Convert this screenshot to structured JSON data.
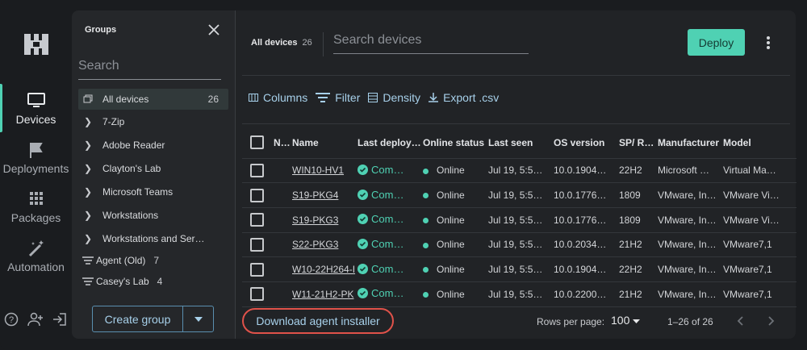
{
  "nav": {
    "devices": "Devices",
    "deployments": "Deployments",
    "packages": "Packages",
    "automation": "Automation"
  },
  "groups": {
    "title": "Groups",
    "search_placeholder": "Search",
    "items": [
      {
        "label": "All devices",
        "count": "26"
      },
      {
        "label": "7-Zip"
      },
      {
        "label": "Adobe Reader"
      },
      {
        "label": "Clayton's Lab"
      },
      {
        "label": "Microsoft Teams"
      },
      {
        "label": "Workstations"
      },
      {
        "label": "Workstations and Ser…"
      },
      {
        "label": "Agent (Old)",
        "count": "7"
      },
      {
        "label": "Casey's Lab",
        "count": "4"
      }
    ],
    "create_label": "Create group"
  },
  "header": {
    "title": "All devices",
    "count": "26",
    "search_placeholder": "Search devices",
    "deploy_label": "Deploy"
  },
  "toolbar": {
    "columns": "Columns",
    "filter": "Filter",
    "density": "Density",
    "export": "Export .csv"
  },
  "table": {
    "columns": [
      "N…",
      "Name",
      "Last deploy…",
      "Online status",
      "Last seen",
      "OS version",
      "SP/ R…",
      "Manufacturer",
      "Model"
    ],
    "rows": [
      {
        "name": "WIN10-HV1",
        "deploy": "Com…",
        "online": "Online",
        "seen": "Jul 19, 5:5…",
        "os": "10.0.1904…",
        "sp": "22H2",
        "mfr": "Microsoft …",
        "model": "Virtual Ma…"
      },
      {
        "name": "S19-PKG4",
        "deploy": "Com…",
        "online": "Online",
        "seen": "Jul 19, 5:5…",
        "os": "10.0.1776…",
        "sp": "1809",
        "mfr": "VMware, In…",
        "model": "VMware Vi…"
      },
      {
        "name": "S19-PKG3",
        "deploy": "Com…",
        "online": "Online",
        "seen": "Jul 19, 5:5…",
        "os": "10.0.1776…",
        "sp": "1809",
        "mfr": "VMware, In…",
        "model": "VMware Vi…"
      },
      {
        "name": "S22-PKG3",
        "deploy": "Com…",
        "online": "Online",
        "seen": "Jul 19, 5:5…",
        "os": "10.0.2034…",
        "sp": "21H2",
        "mfr": "VMware, In…",
        "model": "VMware7,1"
      },
      {
        "name": "W10-22H264-I",
        "deploy": "Com…",
        "online": "Online",
        "seen": "Jul 19, 5:5…",
        "os": "10.0.1904…",
        "sp": "22H2",
        "mfr": "VMware, In…",
        "model": "VMware7,1"
      },
      {
        "name": "W11-21H2-PK",
        "deploy": "Com…",
        "online": "Online",
        "seen": "Jul 19, 5:5…",
        "os": "10.0.2200…",
        "sp": "21H2",
        "mfr": "VMware, In…",
        "model": "VMware7,1"
      }
    ]
  },
  "footer": {
    "download_label": "Download agent installer",
    "rows_per_page_label": "Rows per page:",
    "rows_per_page_value": "100",
    "range": "1–26 of 26"
  },
  "colors": {
    "accent": "#4fd1b3",
    "link": "#a7d0ea",
    "highlight_ring": "#e0524a"
  }
}
